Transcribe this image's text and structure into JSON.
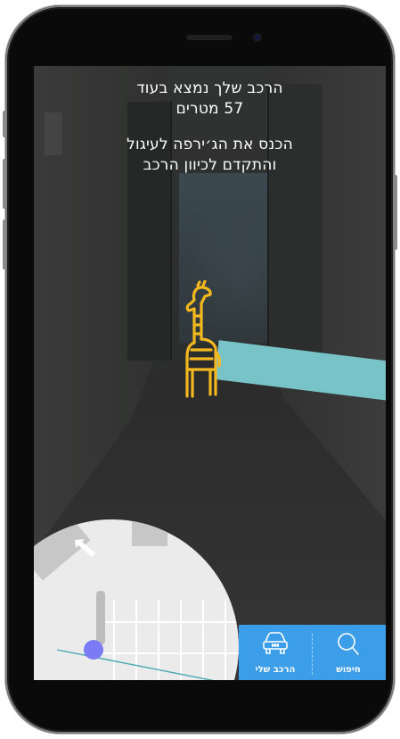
{
  "instructions": {
    "distance_line": "הרכב שלך נמצא בעוד",
    "distance_value": "57 מטרים",
    "guide_line_1": "הכנס את הג׳ירפה לעיגול",
    "guide_line_2": "והתקדם לכיוון הרכב"
  },
  "bottom_nav": {
    "my_car_label": "הרכב שלי",
    "search_label": "חיפוש",
    "my_car_icon": "car-icon",
    "search_icon": "search-icon"
  },
  "colors": {
    "nav_background": "#3c9ee8",
    "ar_beam": "#77c3c8",
    "giraffe": "#f2b81e",
    "user_dot": "#7b7bf5",
    "minimap_background": "#ebebeb"
  }
}
